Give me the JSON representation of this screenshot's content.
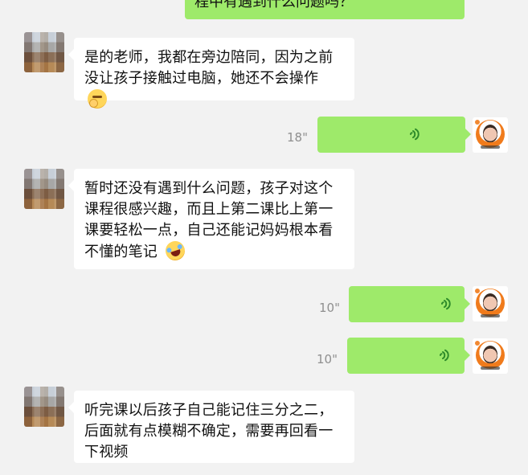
{
  "messages": [
    {
      "side": "left",
      "text": "是的老师，我都在旁边陪同，因为之前没让孩子接触过电脑，她还不会操作",
      "emoji": "thinking-face-emoji"
    },
    {
      "side": "right",
      "type": "voice",
      "duration": "18\""
    },
    {
      "side": "left",
      "text": "暂时还没有遇到什么问题，孩子对这个课程很感兴趣，而且上第二课比上第一课要轻松一点，自己还能记妈妈根本看不懂的笔记",
      "emoji": "laughing-face-emoji"
    },
    {
      "side": "right",
      "type": "voice",
      "duration": "10\""
    },
    {
      "side": "right",
      "type": "voice",
      "duration": "10\""
    },
    {
      "side": "left",
      "text": "听完课以后孩子自己能记住三分之二，后面就有点模糊不确定，需要再回看一下视频",
      "emoji": ""
    }
  ],
  "top_bubble_text": "程中有遇到什么问题吗？",
  "colors": {
    "background": "#f2f2f2",
    "outgoing_bubble": "#9eea6a",
    "incoming_bubble": "#ffffff",
    "duration_text": "#8f8f8f"
  },
  "icons": {
    "voice": "voice-wave-icon",
    "emoji1": "thinking-face-emoji",
    "emoji2": "laughing-face-emoji"
  }
}
